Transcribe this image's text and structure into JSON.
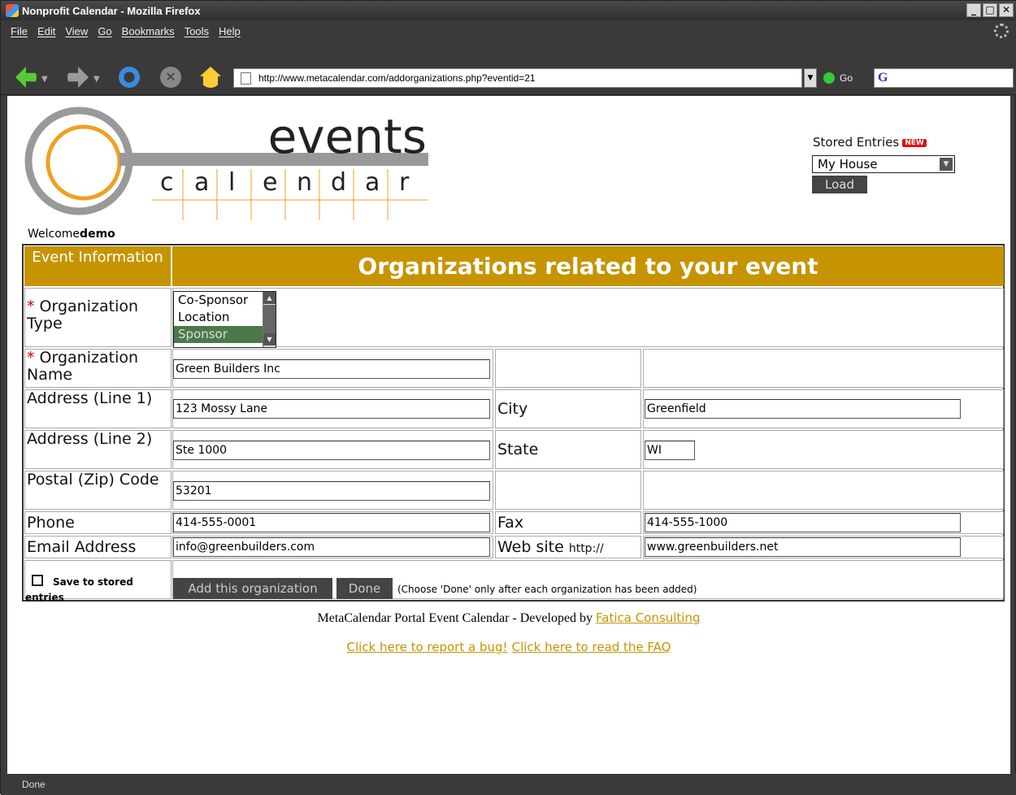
{
  "window": {
    "title": "Nonprofit Calendar - Mozilla Firefox"
  },
  "menu": [
    "File",
    "Edit",
    "View",
    "Go",
    "Bookmarks",
    "Tools",
    "Help"
  ],
  "nav": {
    "url": "http://www.metacalendar.com/addorganizations.php?eventid=21",
    "go_label": "Go",
    "search_logo": "G"
  },
  "logo": {
    "word1": "events",
    "letters": [
      "c",
      "a",
      "l",
      "e",
      "n",
      "d",
      "a",
      "r"
    ]
  },
  "welcome": {
    "prefix": "Welcome",
    "user": "demo"
  },
  "stored": {
    "label": "Stored Entries",
    "badge": "NEW",
    "selected": "My House",
    "load_label": "Load"
  },
  "form": {
    "left_header": "Event Information",
    "main_header": "Organizations related to your event",
    "required_mark": "*",
    "org_type_label": "Organization Type",
    "org_type_options": [
      "Co-Sponsor",
      "Location",
      "Sponsor"
    ],
    "org_type_selected": "Sponsor",
    "org_name_label": "Organization Name",
    "org_name": "Green Builders Inc",
    "addr1_label": "Address (Line 1)",
    "addr1": "123 Mossy Lane",
    "city_label": "City",
    "city": "Greenfield",
    "addr2_label": "Address (Line 2)",
    "addr2": "Ste 1000",
    "state_label": "State",
    "state": "WI",
    "zip_label": "Postal (Zip) Code",
    "zip": "53201",
    "phone_label": "Phone",
    "phone": "414-555-0001",
    "fax_label": "Fax",
    "fax": "414-555-1000",
    "email_label": "Email Address",
    "email": "info@greenbuilders.com",
    "web_label": "Web site",
    "web_prefix": "http://",
    "web": "www.greenbuilders.net",
    "save_label": "Save to stored entries",
    "add_label": "Add this organization",
    "done_label": "Done",
    "done_note": "(Choose 'Done' only after each organization has been added)"
  },
  "footer": {
    "text": "MetaCalendar Portal Event Calendar - Developed by",
    "link": "Fatica Consulting",
    "bug_link": "Click here to report a bug!",
    "faq_link": "Click here to read the FAQ"
  },
  "status": {
    "text": "Done"
  },
  "colors": {
    "header_gold": "#c59400",
    "link_gold": "#c59400",
    "required_red": "#cc0000"
  }
}
